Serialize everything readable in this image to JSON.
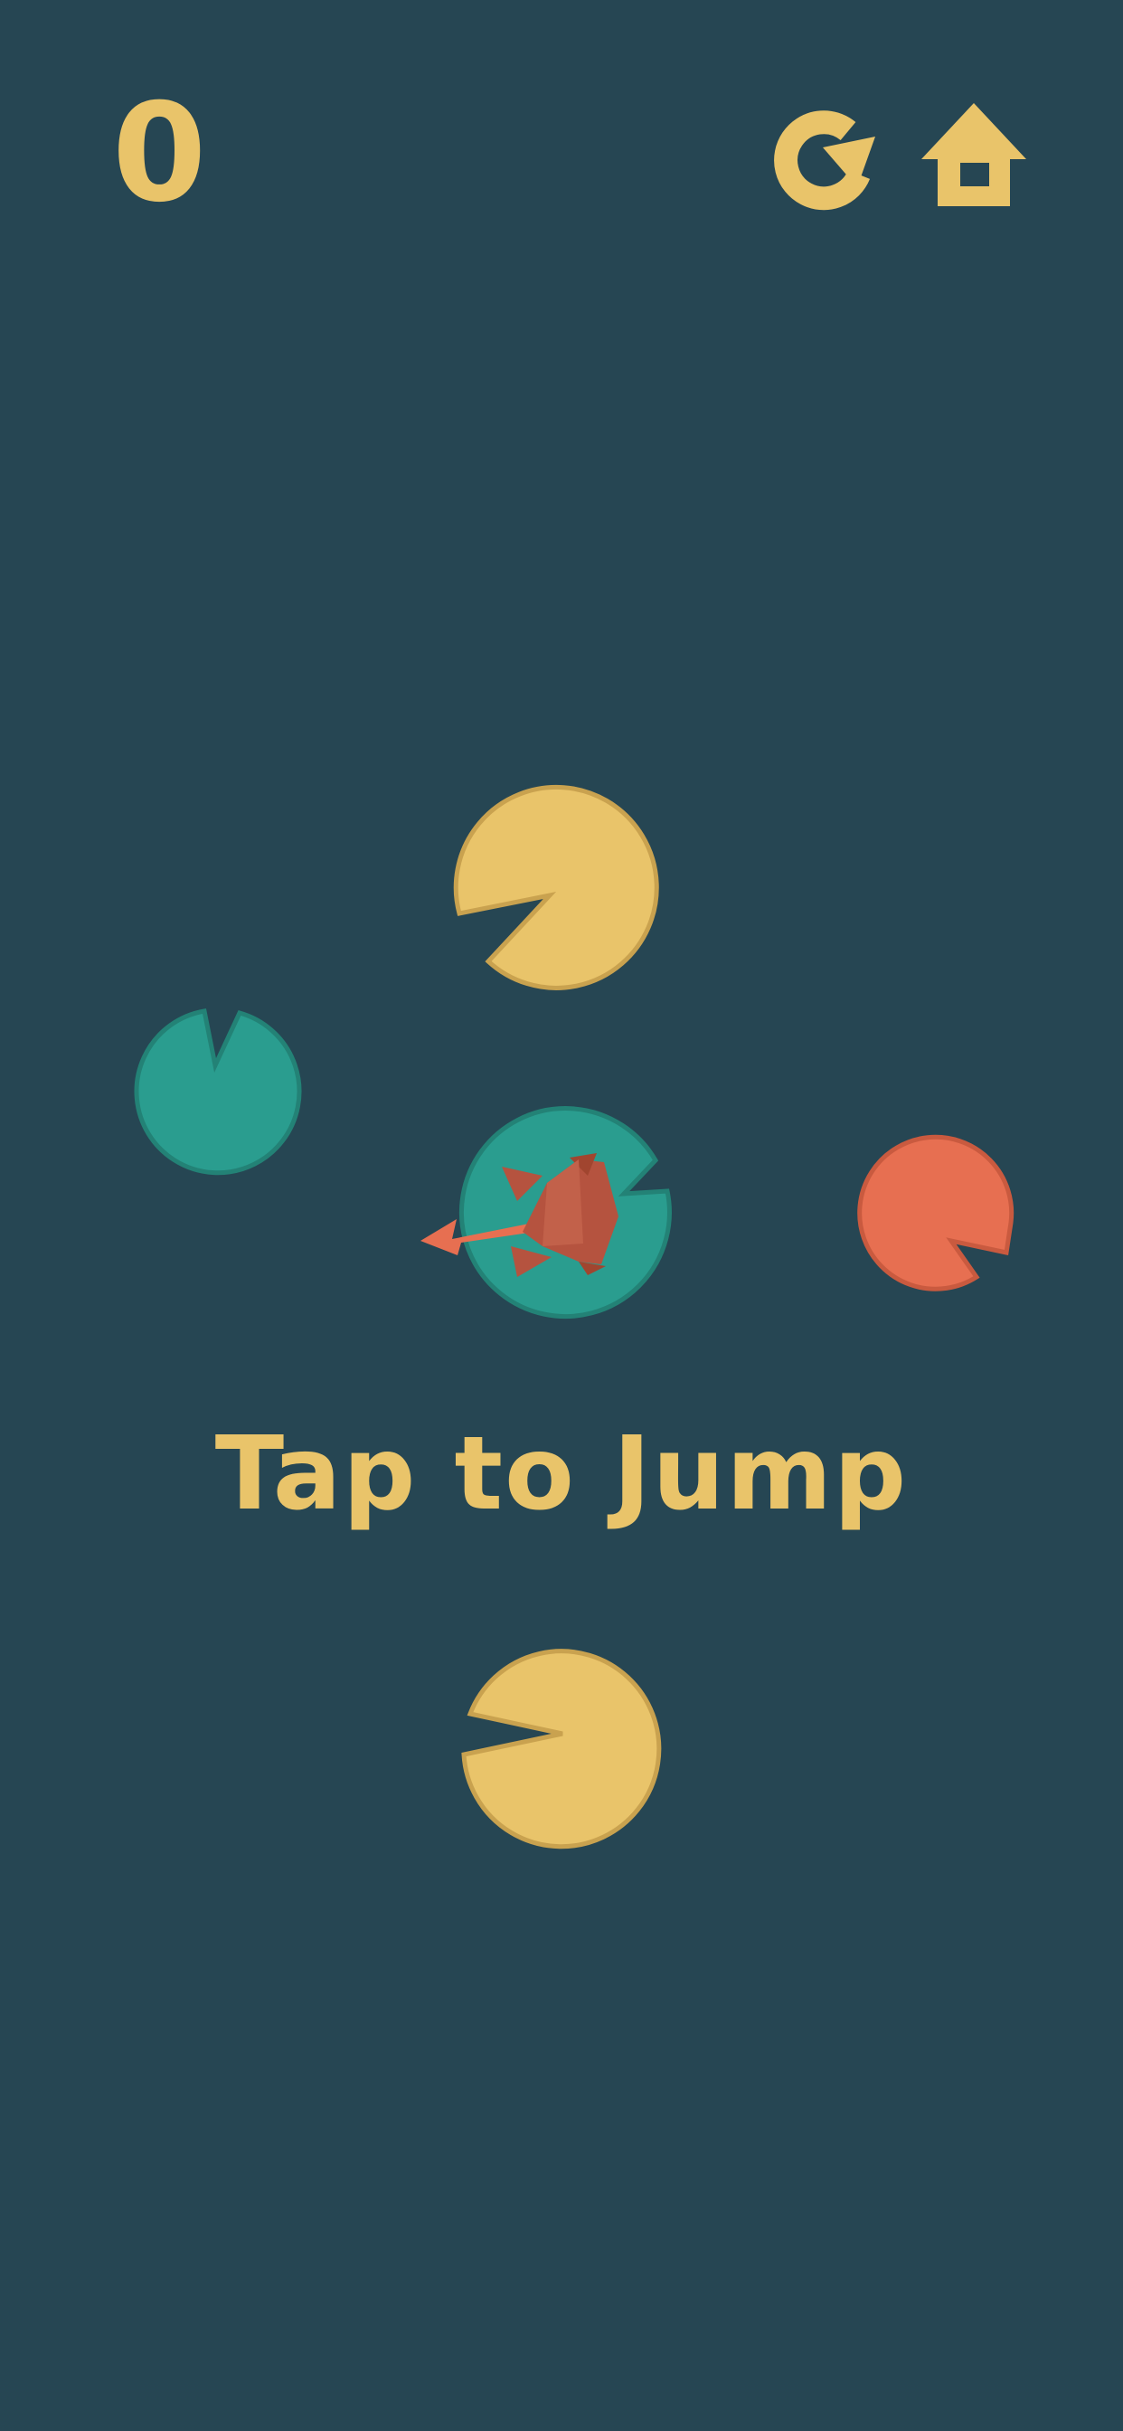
{
  "game": {
    "score": "0",
    "hint": "Tap to Jump"
  },
  "controls": {
    "restart_icon": "restart-arrow-icon",
    "home_icon": "home-icon"
  },
  "colors": {
    "background": "#264653",
    "accent_yellow": "#E9C46A",
    "lily_teal": "#2A9D8F",
    "lily_coral": "#E76F51",
    "frog_body": "#B5533F"
  },
  "lily_pads": [
    {
      "color": "yellow"
    },
    {
      "color": "teal"
    },
    {
      "color": "teal",
      "occupied_by_frog": true
    },
    {
      "color": "coral"
    },
    {
      "color": "yellow"
    }
  ]
}
